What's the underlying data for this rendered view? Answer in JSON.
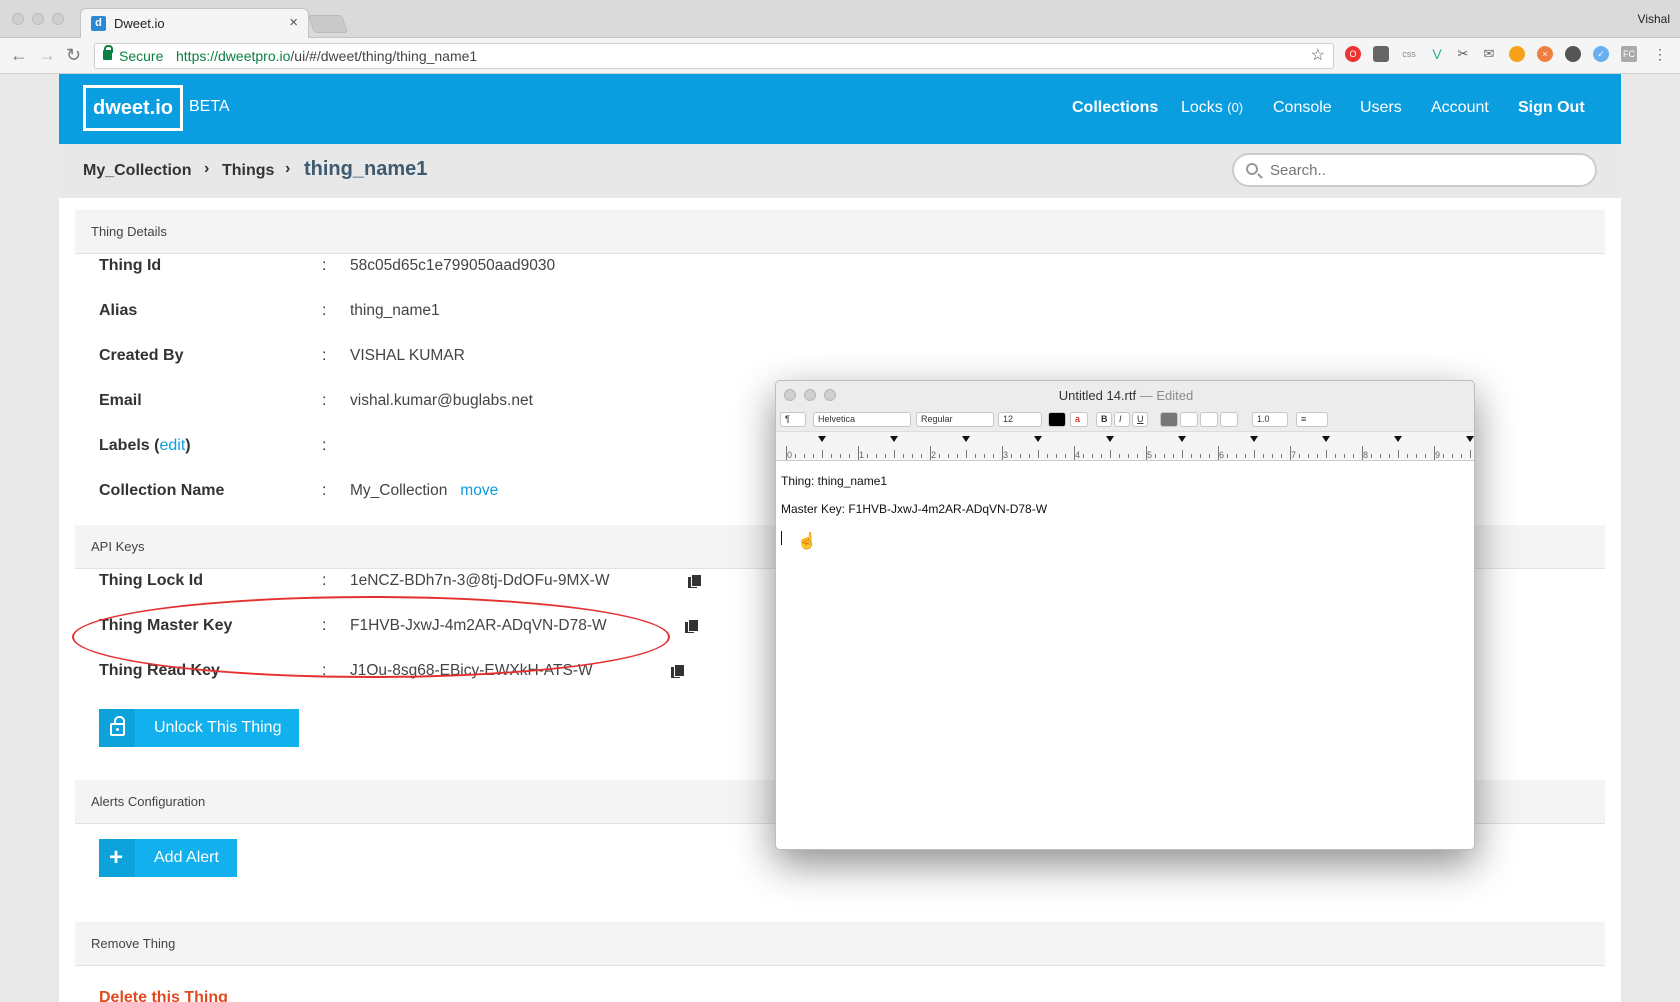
{
  "browser": {
    "tab_title": "Dweet.io",
    "tab_favicon": "d",
    "tab_close": "×",
    "user": "Vishal",
    "secure_label": "Secure",
    "url_host": "https://dweetpro.io",
    "url_path": "/ui/#/dweet/thing/thing_name1",
    "extensions": [
      "opera-icon",
      "pocket-icon",
      "css-icon",
      "vue-icon",
      "scissors-icon",
      "mail-icon",
      "color-icon",
      "close-circle-icon",
      "badge-icon",
      "check-icon",
      "fc-icon",
      "menu-icon"
    ]
  },
  "header": {
    "logo": "dweet.io",
    "beta": "BETA",
    "nav": {
      "collections": "Collections",
      "locks": "Locks",
      "locks_count": "(0)",
      "console": "Console",
      "users": "Users",
      "account": "Account",
      "signout": "Sign Out"
    },
    "accent_color": "#0a9de0"
  },
  "breadcrumb": {
    "collection": "My_Collection",
    "things": "Things",
    "current": "thing_name1",
    "search_placeholder": "Search.."
  },
  "thing_details": {
    "section": "Thing Details",
    "thing_id_label": "Thing Id",
    "thing_id": "58c05d65c1e799050aad9030",
    "alias_label": "Alias",
    "alias": "thing_name1",
    "created_by_label": "Created By",
    "created_by": "VISHAL KUMAR",
    "email_label": "Email",
    "email": "vishal.kumar@buglabs.net",
    "labels_label": "Labels (",
    "labels_edit": "edit",
    "labels_close": ")",
    "collection_label": "Collection Name",
    "collection": "My_Collection",
    "move": "move",
    "colon": ":"
  },
  "api_keys": {
    "section": "API Keys",
    "lock_label": "Thing Lock Id",
    "lock_id": "1eNCZ-BDh7n-3@8tj-DdOFu-9MX-W",
    "master_label": "Thing Master Key",
    "master_key": "F1HVB-JxwJ-4m2AR-ADqVN-D78-W",
    "read_label": "Thing Read Key",
    "read_key": "J1Ou-8sg68-EBicy-EWXkH-ATS-W",
    "unlock_button": "Unlock This Thing"
  },
  "alerts": {
    "section": "Alerts Configuration",
    "add_alert": "Add Alert"
  },
  "remove": {
    "section": "Remove Thing",
    "delete": "Delete this Thing"
  },
  "textedit": {
    "title": "Untitled 14.rtf",
    "edited": " — Edited",
    "font": "Helvetica",
    "style": "Regular",
    "size": "12",
    "spacing": "1.0",
    "ruler_numbers": [
      "0",
      "1",
      "2",
      "3",
      "4",
      "5",
      "6",
      "7",
      "8",
      "9"
    ],
    "line1": "Thing:  thing_name1",
    "line2": "Master Key:  F1HVB-JxwJ-4m2AR-ADqVN-D78-W"
  }
}
